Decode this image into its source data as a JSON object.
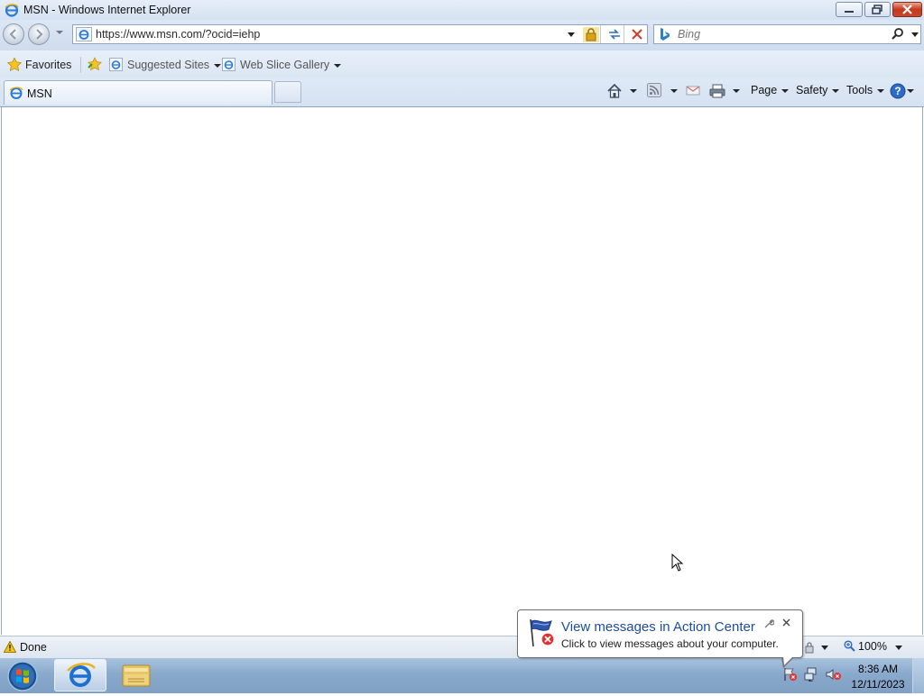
{
  "window": {
    "title": "MSN - Windows Internet Explorer"
  },
  "navigation": {
    "address": "https://www.msn.com/?ocid=iehp",
    "search_placeholder": "Bing"
  },
  "favorites_bar": {
    "favorites_label": "Favorites",
    "suggested_sites_label": "Suggested Sites",
    "web_slice_gallery_label": "Web Slice Gallery"
  },
  "tabs": [
    {
      "label": "MSN"
    }
  ],
  "command_bar": {
    "page_label": "Page",
    "safety_label": "Safety",
    "tools_label": "Tools"
  },
  "status_bar": {
    "status_text": "Done",
    "zoom": "100%"
  },
  "notification": {
    "title": "View messages in Action Center",
    "message": "Click to view messages about your computer."
  },
  "taskbar": {
    "time": "8:36 AM",
    "date": "12/11/2023"
  },
  "colors": {
    "accent_title_blue": "#1c4ea0",
    "close_button_red": "#c4391d"
  }
}
